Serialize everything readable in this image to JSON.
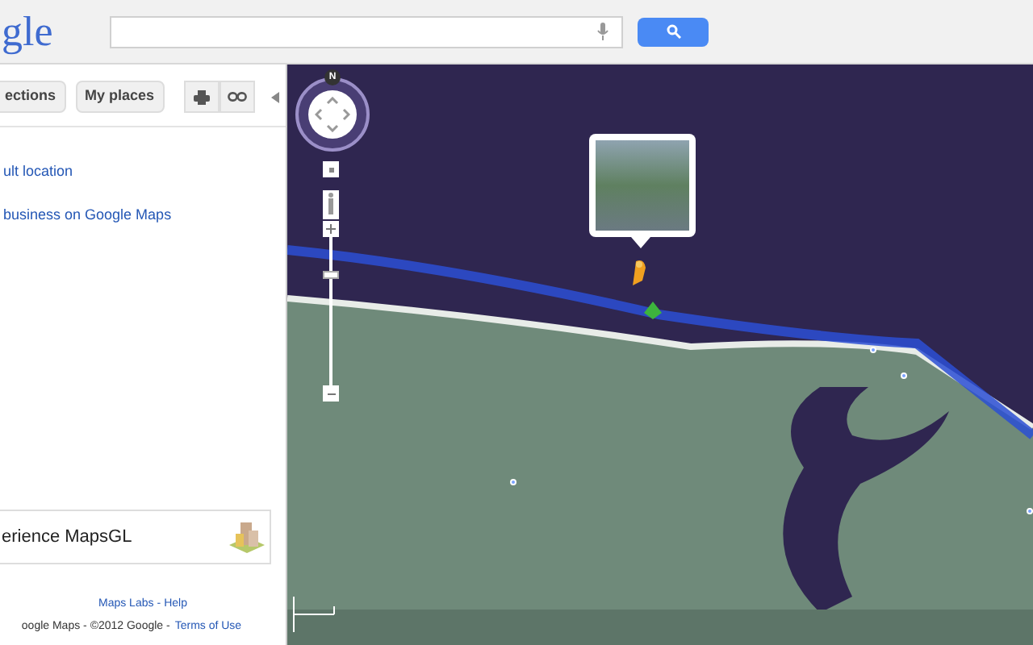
{
  "header": {
    "logo": "gle"
  },
  "panel": {
    "buttons": [
      {
        "label": "ections"
      },
      {
        "label": "My places"
      }
    ],
    "links": [
      "ult location",
      "business on Google Maps"
    ],
    "promo": {
      "label": "erience MapsGL"
    },
    "footer": {
      "links": [
        "Maps Labs",
        "Help"
      ],
      "separator": "-",
      "copyright": "oogle Maps - ©2012 Google -",
      "terms": "Terms of Use"
    }
  },
  "map": {
    "compass": "N"
  }
}
